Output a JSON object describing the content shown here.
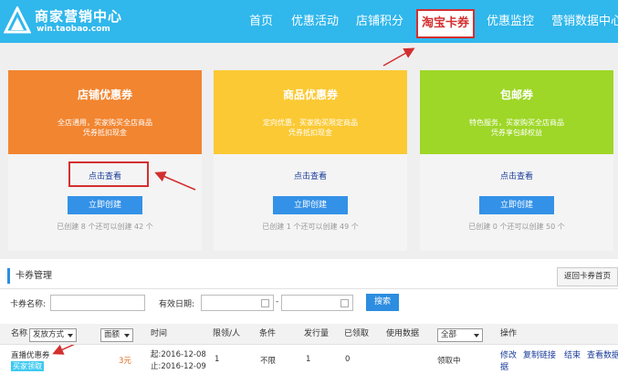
{
  "header": {
    "logo_title": "商家营销中心",
    "logo_sub": "win.taobao.com",
    "nav": [
      "首页",
      "优惠活动",
      "店铺积分",
      "淘宝卡券",
      "优惠监控",
      "营销数据中心"
    ],
    "active_nav": "淘宝卡券"
  },
  "cards": [
    {
      "title": "店铺优惠券",
      "desc1": "全店通用，买家购买全店商品",
      "desc2": "凭券抵扣现金",
      "view": "点击查看",
      "create": "立即创建",
      "note": "已创建 8 个还可以创建 42 个",
      "color": "#f28530"
    },
    {
      "title": "商品优惠券",
      "desc1": "定向优惠，买家购买限定商品",
      "desc2": "凭券抵扣现金",
      "view": "点击查看",
      "create": "立即创建",
      "note": "已创建 1 个还可以创建 49 个",
      "color": "#fbc934"
    },
    {
      "title": "包邮券",
      "desc1": "特色服务，买家购买全店商品",
      "desc2": "凭券享包邮权益",
      "view": "点击查看",
      "create": "立即创建",
      "note": "已创建 0 个还可以创建 50 个",
      "color": "#9ed727"
    }
  ],
  "management": {
    "title": "卡券管理",
    "return_btn": "返回卡券首页",
    "filter_name_label": "卡券名称:",
    "filter_date_label": "有效日期:",
    "date_sep": "-",
    "search_btn": "搜索"
  },
  "table": {
    "col_name": "名称",
    "sel_method": "发放方式",
    "sel_amount": "面额",
    "col_time": "时间",
    "col_limit": "限领/人",
    "col_cond": "条件",
    "col_issued": "发行量",
    "col_claimed": "已领取",
    "col_used": "使用数据",
    "sel_status": "全部",
    "col_ops": "操作",
    "row": {
      "name": "直播优惠券",
      "tag": "买家领取",
      "amount": "3元",
      "start": "起:2016-12-08",
      "end": "止:2016-12-09",
      "limit": "1",
      "cond": "不限",
      "issued": "1",
      "claimed": "0",
      "status": "领取中",
      "ops": [
        "修改",
        "复制链接",
        "结束",
        "查看数据"
      ],
      "op_edit_line2": "据"
    }
  }
}
